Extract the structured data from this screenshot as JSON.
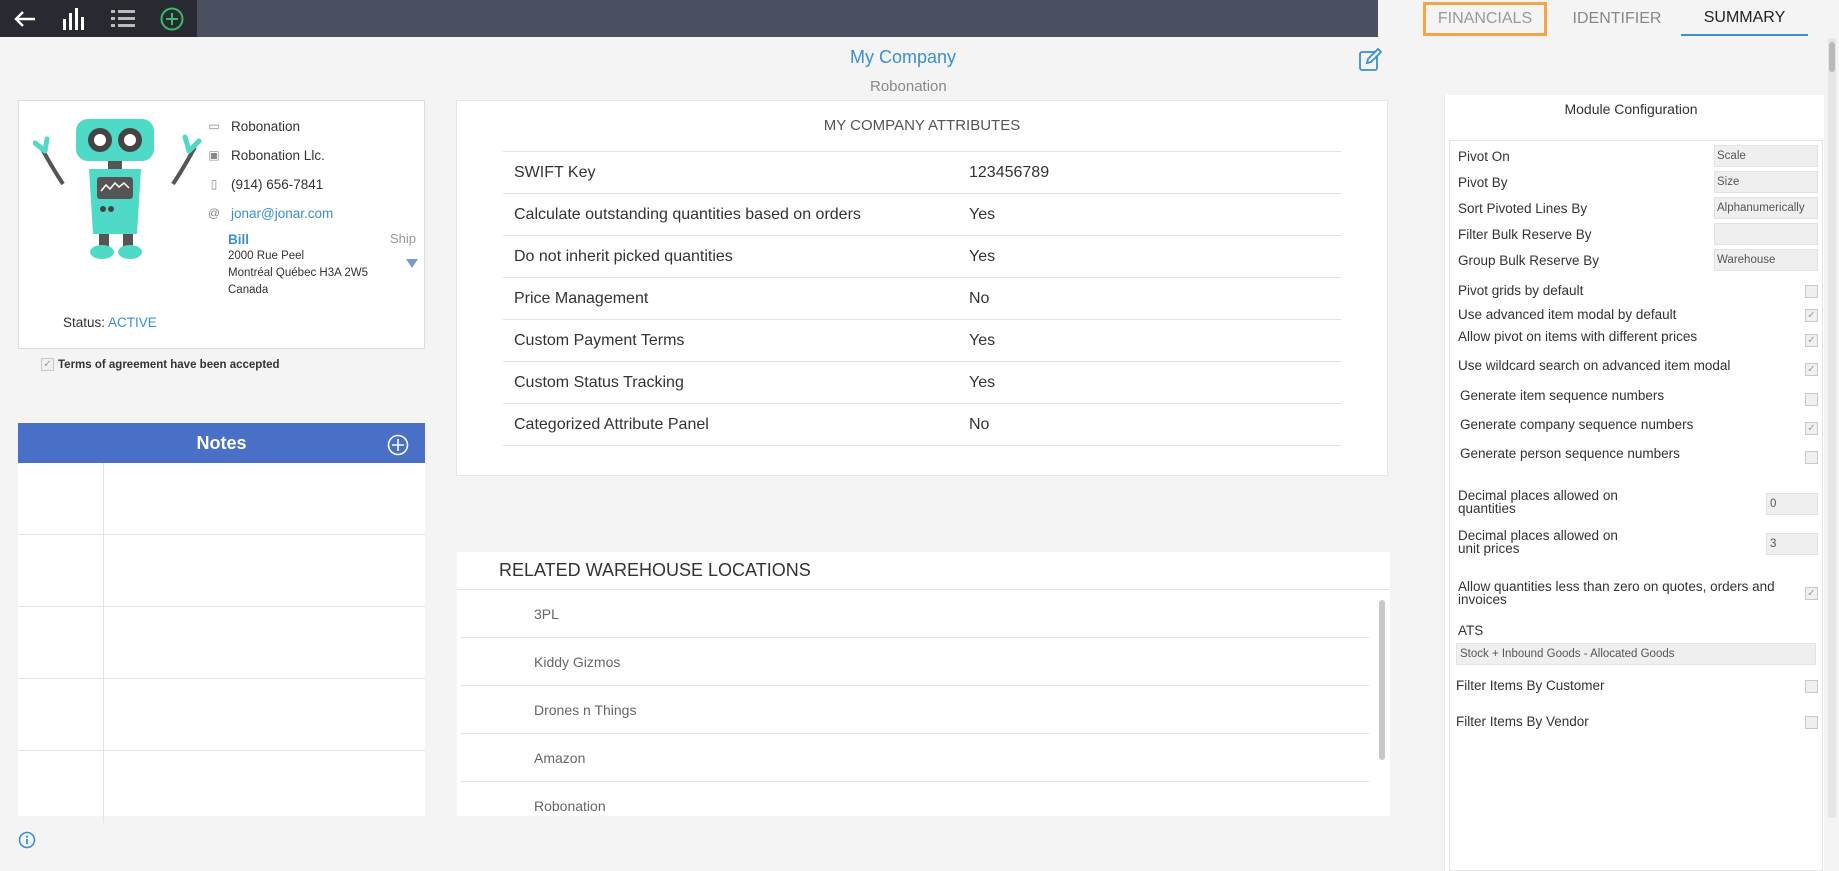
{
  "toolbar": {
    "icons": [
      "back-arrow-icon",
      "bar-chart-icon",
      "list-icon",
      "add-circle-icon"
    ]
  },
  "header": {
    "company_name": "My Company",
    "company_subtitle": "Robonation"
  },
  "profile": {
    "name": "Robonation",
    "legal_name": "Robonation Llc.",
    "phone": "(914) 656-7841",
    "email": "jonar@jonar.com",
    "address_bill_label": "Bill",
    "address_ship_label": "Ship",
    "address_line1": "2000 Rue Peel",
    "address_line2": "Montréal Québec H3A 2W5",
    "address_line3": "Canada",
    "status_label": "Status:",
    "status_value": "ACTIVE",
    "terms_label": "Terms of agreement have been accepted",
    "terms_accepted": true
  },
  "notes": {
    "title": "Notes"
  },
  "attributes": {
    "title": "MY COMPANY ATTRIBUTES",
    "rows": [
      {
        "key": "SWIFT Key",
        "value": "123456789"
      },
      {
        "key": "Calculate outstanding quantities based on orders",
        "value": "Yes"
      },
      {
        "key": "Do not inherit picked quantities",
        "value": "Yes"
      },
      {
        "key": "Price Management",
        "value": "No"
      },
      {
        "key": "Custom Payment Terms",
        "value": "Yes"
      },
      {
        "key": "Custom Status Tracking",
        "value": "Yes"
      },
      {
        "key": "Categorized Attribute Panel",
        "value": "No"
      }
    ]
  },
  "warehouses": {
    "title": "RELATED WAREHOUSE LOCATIONS",
    "items": [
      "3PL",
      "Kiddy Gizmos",
      "Drones n Things",
      "Amazon",
      "Robonation"
    ]
  },
  "tabs": {
    "financials": "FINANCIALS",
    "identifier": "IDENTIFIER",
    "summary": "SUMMARY"
  },
  "module": {
    "title": "Module Configuration",
    "pivot_on": {
      "label": "Pivot On",
      "value": "Scale"
    },
    "pivot_by": {
      "label": "Pivot By",
      "value": "Size"
    },
    "sort_pivoted": {
      "label": "Sort Pivoted Lines By",
      "value": "Alphanumerically"
    },
    "filter_bulk": {
      "label": "Filter Bulk Reserve By",
      "value": ""
    },
    "group_bulk": {
      "label": "Group Bulk Reserve By",
      "value": "Warehouse"
    },
    "pivot_grids": {
      "label": "Pivot grids by default",
      "checked": false
    },
    "advanced_modal": {
      "label": "Use advanced item modal by default",
      "checked": true
    },
    "allow_pivot": {
      "label": "Allow pivot on items with different prices",
      "checked": true
    },
    "wildcard": {
      "label": "Use wildcard search on advanced item modal",
      "checked": true
    },
    "gen_item": {
      "label": "Generate item sequence numbers",
      "checked": false
    },
    "gen_company": {
      "label": "Generate company sequence numbers",
      "checked": true
    },
    "gen_person": {
      "label": "Generate person sequence numbers",
      "checked": false
    },
    "dec_qty": {
      "label_1": "Decimal places allowed on",
      "label_2": "quantities",
      "value": "0"
    },
    "dec_price": {
      "label_1": "Decimal places allowed on",
      "label_2": "unit prices",
      "value": "3"
    },
    "allow_negative": {
      "label_1": "Allow quantities less than zero on quotes, orders and",
      "label_2": "invoices",
      "checked": true
    },
    "ats_label": "ATS",
    "ats_value": "Stock + Inbound Goods - Allocated Goods",
    "filter_customer": {
      "label": "Filter Items By Customer",
      "checked": false
    },
    "filter_vendor": {
      "label": "Filter Items By Vendor",
      "checked": false
    }
  }
}
